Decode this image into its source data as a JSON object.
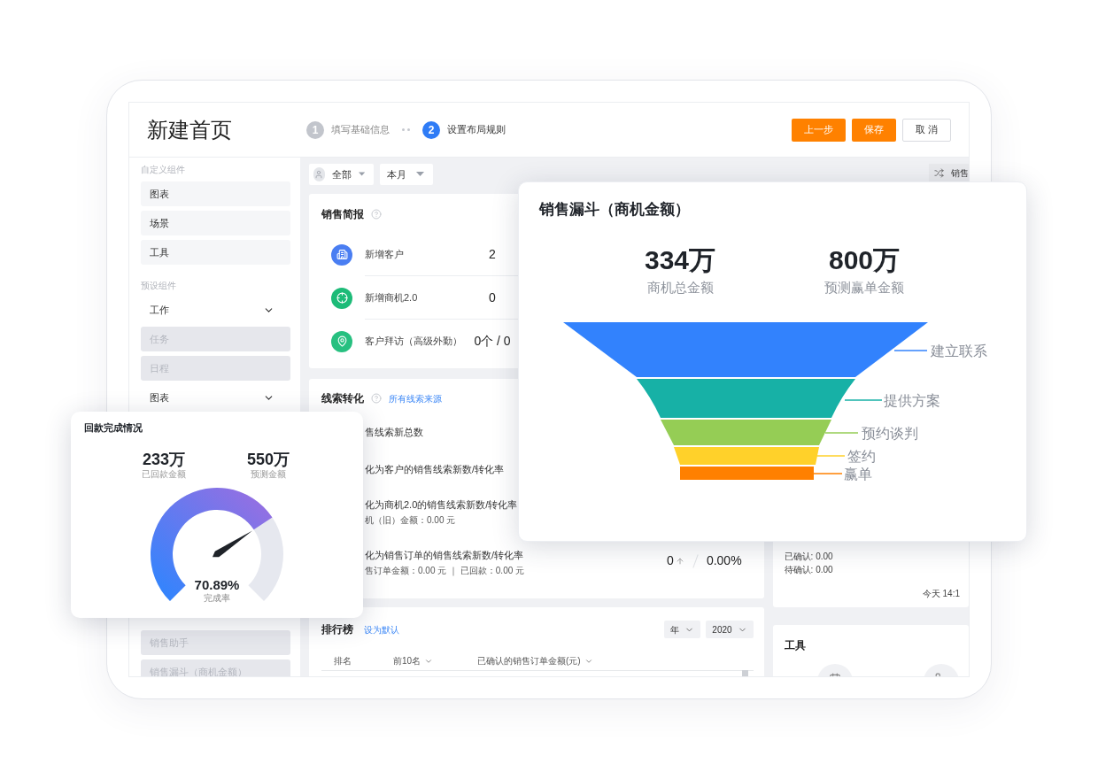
{
  "page": {
    "title": "新建首页"
  },
  "steps": [
    {
      "number": "1",
      "label": "填写基础信息",
      "selected": false
    },
    {
      "number": "2",
      "label": "设置布局规则",
      "selected": true
    }
  ],
  "buttons": [
    {
      "label": "上一步",
      "kind": "primary"
    },
    {
      "label": "保存",
      "kind": "primary"
    },
    {
      "label": "取 消",
      "kind": "default"
    }
  ],
  "sidebar": {
    "sections": [
      {
        "title": "自定义组件",
        "items": [
          {
            "kind": "item",
            "label": "图表",
            "disabled": false
          },
          {
            "kind": "item",
            "label": "场景",
            "disabled": false
          },
          {
            "kind": "item",
            "label": "工具",
            "disabled": false
          }
        ]
      },
      {
        "title": "预设组件",
        "items": [
          {
            "kind": "group",
            "label": "工作",
            "expanded": true,
            "children": [
              {
                "label": "任务",
                "disabled": true
              },
              {
                "label": "日程",
                "disabled": true
              }
            ]
          },
          {
            "kind": "group",
            "label": "图表",
            "expanded": true,
            "children": [
              {
                "label": "销售助手",
                "disabled": true
              },
              {
                "label": "销售漏斗（商机金额）",
                "disabled": true
              }
            ]
          }
        ]
      }
    ]
  },
  "filters": [
    {
      "kind": "user",
      "label": "全部"
    },
    {
      "kind": "plain",
      "label": "本月"
    }
  ],
  "switch_button": {
    "label": "销售"
  },
  "sales_brief": {
    "title": "销售简报",
    "rows": [
      {
        "kind": "building",
        "color": "#4a7ef2",
        "label": "新增客户",
        "value": "2"
      },
      {
        "kind": "target",
        "color": "#1dbb78",
        "label": "新增商机2.0",
        "value": "0"
      },
      {
        "kind": "pin",
        "color": "#27c080",
        "label": "客户拜访（高级外勤）",
        "value": "0个 / 0"
      }
    ]
  },
  "lead_conversion": {
    "title": "线索转化",
    "link": "所有线索来源",
    "rows": [
      {
        "label": "售线索新总数"
      },
      {
        "label": "化为客户的销售线索新数/转化率"
      },
      {
        "label": "化为商机2.0的销售线索新数/转化率",
        "detail": "机（旧）金额：0.00 元"
      },
      {
        "label": "化为销售订单的销售线索新数/转化率",
        "detail": "售订单金额：0.00 元 ｜ 已回款：0.00 元",
        "count": "0",
        "rate": "0.00%"
      }
    ]
  },
  "ranking": {
    "title": "排行榜",
    "link": "设为默认",
    "selects": [
      "年",
      "2020"
    ],
    "columns": [
      {
        "label": "排名",
        "sortable": false
      },
      {
        "label": "前10名",
        "sortable": true
      },
      {
        "label": "已确认的销售订单金额(元)",
        "sortable": true
      }
    ]
  },
  "side_panel": {
    "lines": [
      "已确认: 0.00",
      "待确认: 0.00"
    ],
    "time": "今天 14:1"
  },
  "tools": {
    "title": "工具"
  },
  "funnel_card": {
    "title": "销售漏斗（商机金额）",
    "stats": [
      {
        "value": "334万",
        "label": "商机总金额"
      },
      {
        "value": "800万",
        "label": "预测赢单金额"
      }
    ],
    "stages": [
      {
        "label": "建立联系",
        "color": "#3282fd"
      },
      {
        "label": "提供方案",
        "color": "#17b1a6"
      },
      {
        "label": "预约谈判",
        "color": "#95cd55"
      },
      {
        "label": "签约",
        "color": "#ffd12a"
      },
      {
        "label": "赢单",
        "color": "#ff8000"
      }
    ]
  },
  "gauge_card": {
    "title": "回款完成情况",
    "stats": [
      {
        "value": "233万",
        "label": "已回款金额"
      },
      {
        "value": "550万",
        "label": "预测金额"
      }
    ],
    "level": 0.7089,
    "reading": "70.89%",
    "reading_label": "完成率"
  }
}
